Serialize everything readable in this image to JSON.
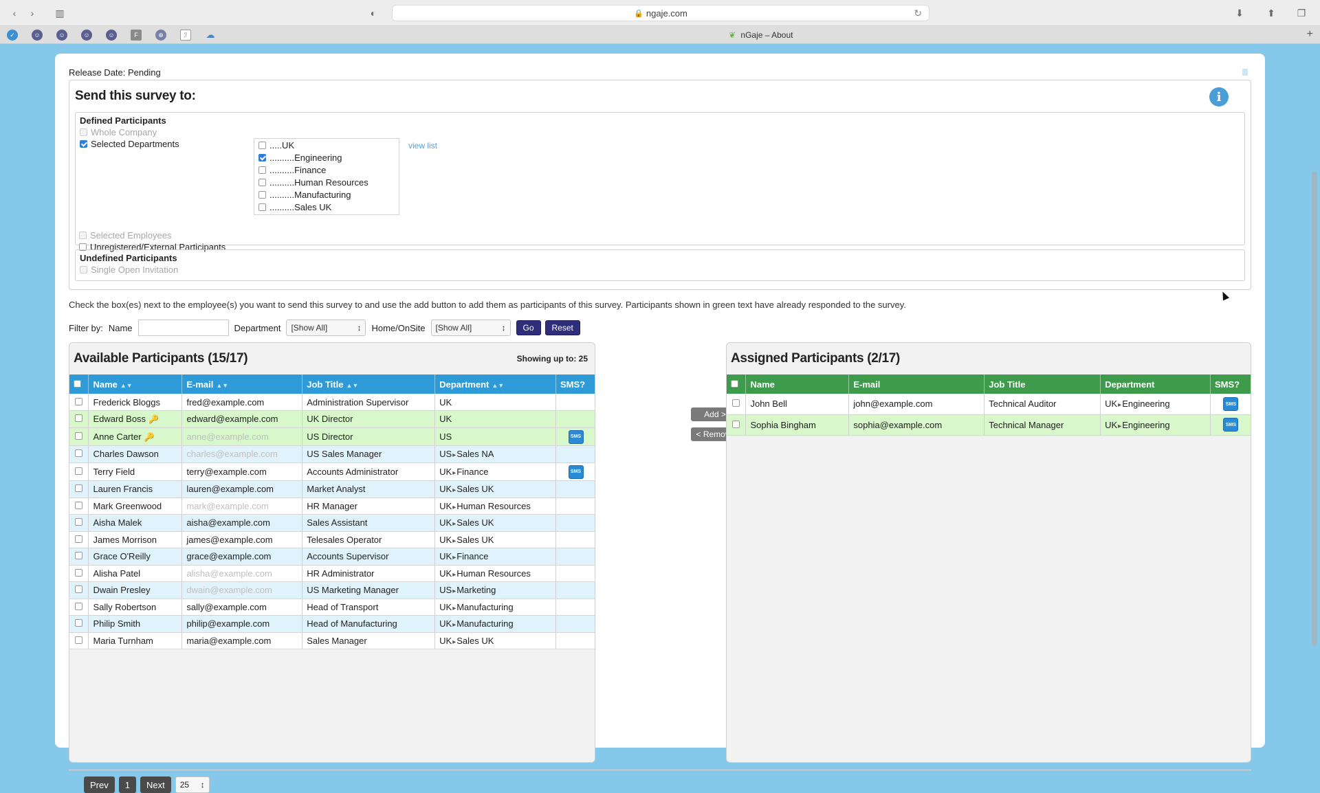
{
  "browser": {
    "url": "ngaje.com",
    "tab_title": "nGaje – About",
    "bookmark_letter": "F"
  },
  "release": {
    "label": "Release Date:",
    "value": "Pending"
  },
  "send": {
    "title": "Send this survey to:",
    "defined_title": "Defined Participants",
    "whole_company": "Whole Company",
    "selected_departments": "Selected Departments",
    "view_list": "view list",
    "departments": [
      {
        "label": ".....UK",
        "checked": false
      },
      {
        "label": "..........Engineering",
        "checked": true
      },
      {
        "label": "..........Finance",
        "checked": false
      },
      {
        "label": "..........Human Resources",
        "checked": false
      },
      {
        "label": "..........Manufacturing",
        "checked": false
      },
      {
        "label": "..........Sales UK",
        "checked": false
      }
    ],
    "selected_employees": "Selected Employees",
    "unregistered": "Unregistered/External Participants",
    "undefined_title": "Undefined Participants",
    "single_open": "Single Open Invitation"
  },
  "instructions": "Check the box(es) next to the employee(s) you want to send this survey to and use the add button to add them as participants of this survey. Participants shown in green text have already responded to the survey.",
  "filter": {
    "label": "Filter by:",
    "name_label": "Name",
    "name_value": "",
    "department_label": "Department",
    "department_value": "[Show All]",
    "home_label": "Home/OnSite",
    "home_value": "[Show All]",
    "go": "Go",
    "reset": "Reset"
  },
  "available": {
    "title": "Available Participants (15/17)",
    "showing": "Showing up to: 25",
    "columns": [
      "Name",
      "E-mail",
      "Job Title",
      "Department",
      "SMS?"
    ],
    "rows": [
      {
        "name": "Frederick Bloggs",
        "email": "fred@example.com",
        "email_grey": false,
        "job": "Administration Supervisor",
        "dept": [
          "UK"
        ],
        "sms": false,
        "key": false,
        "tone": "white"
      },
      {
        "name": "Edward Boss",
        "email": "edward@example.com",
        "email_grey": false,
        "job": "UK Director",
        "dept": [
          "UK"
        ],
        "sms": false,
        "key": true,
        "tone": "green"
      },
      {
        "name": "Anne Carter",
        "email": "anne@example.com",
        "email_grey": true,
        "job": "US Director",
        "dept": [
          "US"
        ],
        "sms": true,
        "key": true,
        "tone": "green"
      },
      {
        "name": "Charles Dawson",
        "email": "charles@example.com",
        "email_grey": true,
        "job": "US Sales Manager",
        "dept": [
          "US",
          "Sales NA"
        ],
        "sms": false,
        "key": false,
        "tone": "blue"
      },
      {
        "name": "Terry Field",
        "email": "terry@example.com",
        "email_grey": false,
        "job": "Accounts Administrator",
        "dept": [
          "UK",
          "Finance"
        ],
        "sms": true,
        "key": false,
        "tone": "white"
      },
      {
        "name": "Lauren Francis",
        "email": "lauren@example.com",
        "email_grey": false,
        "job": "Market Analyst",
        "dept": [
          "UK",
          "Sales UK"
        ],
        "sms": false,
        "key": false,
        "tone": "blue"
      },
      {
        "name": "Mark Greenwood",
        "email": "mark@example.com",
        "email_grey": true,
        "job": "HR Manager",
        "dept": [
          "UK",
          "Human Resources"
        ],
        "sms": false,
        "key": false,
        "tone": "white"
      },
      {
        "name": "Aisha Malek",
        "email": "aisha@example.com",
        "email_grey": false,
        "job": "Sales Assistant",
        "dept": [
          "UK",
          "Sales UK"
        ],
        "sms": false,
        "key": false,
        "tone": "blue"
      },
      {
        "name": "James Morrison",
        "email": "james@example.com",
        "email_grey": false,
        "job": "Telesales Operator",
        "dept": [
          "UK",
          "Sales UK"
        ],
        "sms": false,
        "key": false,
        "tone": "white"
      },
      {
        "name": "Grace O'Reilly",
        "email": "grace@example.com",
        "email_grey": false,
        "job": "Accounts Supervisor",
        "dept": [
          "UK",
          "Finance"
        ],
        "sms": false,
        "key": false,
        "tone": "blue"
      },
      {
        "name": "Alisha Patel",
        "email": "alisha@example.com",
        "email_grey": true,
        "job": "HR Administrator",
        "dept": [
          "UK",
          "Human Resources"
        ],
        "sms": false,
        "key": false,
        "tone": "white"
      },
      {
        "name": "Dwain Presley",
        "email": "dwain@example.com",
        "email_grey": true,
        "job": "US Marketing Manager",
        "dept": [
          "US",
          "Marketing"
        ],
        "sms": false,
        "key": false,
        "tone": "blue"
      },
      {
        "name": "Sally Robertson",
        "email": "sally@example.com",
        "email_grey": false,
        "job": "Head of Transport",
        "dept": [
          "UK",
          "Manufacturing"
        ],
        "sms": false,
        "key": false,
        "tone": "white"
      },
      {
        "name": "Philip Smith",
        "email": "philip@example.com",
        "email_grey": false,
        "job": "Head of Manufacturing",
        "dept": [
          "UK",
          "Manufacturing"
        ],
        "sms": false,
        "key": false,
        "tone": "blue"
      },
      {
        "name": "Maria Turnham",
        "email": "maria@example.com",
        "email_grey": false,
        "job": "Sales Manager",
        "dept": [
          "UK",
          "Sales UK"
        ],
        "sms": false,
        "key": false,
        "tone": "white"
      }
    ]
  },
  "assigned": {
    "title": "Assigned Participants (2/17)",
    "columns": [
      "Name",
      "E-mail",
      "Job Title",
      "Department",
      "SMS?"
    ],
    "rows": [
      {
        "name": "John Bell",
        "email": "john@example.com",
        "job": "Technical Auditor",
        "dept": [
          "UK",
          "Engineering"
        ],
        "sms": true,
        "tone": "white"
      },
      {
        "name": "Sophia Bingham",
        "email": "sophia@example.com",
        "job": "Technical Manager",
        "dept": [
          "UK",
          "Engineering"
        ],
        "sms": true,
        "tone": "green"
      }
    ]
  },
  "actions": {
    "add": "Add >",
    "remove": "< Remove"
  },
  "pager": {
    "prev": "Prev",
    "page": "1",
    "next": "Next",
    "per_page": "25"
  },
  "icons": {
    "sms": "SMS",
    "info": "i",
    "key": "🔑"
  },
  "colors": {
    "available_header": "#2e9bd8",
    "assigned_header": "#3e9b4b",
    "responded_row": "#d8f7cb",
    "alt_row": "#e0f2fc",
    "button_primary": "#2f2e7a"
  }
}
